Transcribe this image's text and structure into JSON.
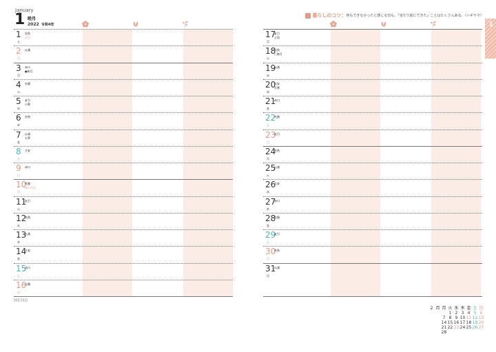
{
  "colors": {
    "accent": "#e39a86",
    "sunday": "#e39a86",
    "saturday": "#4ab6b7",
    "stripe": "#fbece5",
    "text": "#333333"
  },
  "header": {
    "month_en": "January",
    "month_num": "1",
    "month_jp": "睦月",
    "year": "2022",
    "reiwa": "令和4年"
  },
  "column_icons": [
    "flower-icon",
    "leaf-icon",
    "sprout-icon"
  ],
  "tip": {
    "title": "暮らしのコツ：",
    "text": "何もできなかったと感じる日も、「当たり前にできた」ことはたくさんある。（ハギヤマ）"
  },
  "tab_label": "1",
  "memo_label": "MEMO",
  "left_days": [
    {
      "day": "1",
      "weekday": "土",
      "rokuyo": "先負",
      "note": "元日",
      "color": "black",
      "note_color": "red",
      "week_start": false
    },
    {
      "day": "2",
      "weekday": "日",
      "rokuyo": "仏滅",
      "note": "",
      "color": "red",
      "note_color": "black",
      "week_start": false
    },
    {
      "day": "3",
      "weekday": "月",
      "rokuyo": "赤口",
      "note": "●新月",
      "color": "black",
      "note_color": "black",
      "week_start": true
    },
    {
      "day": "4",
      "weekday": "火",
      "rokuyo": "先勝",
      "note": "",
      "color": "black",
      "note_color": "black",
      "week_start": false
    },
    {
      "day": "5",
      "weekday": "水",
      "rokuyo": "友引",
      "note": "小寒",
      "color": "black",
      "note_color": "black",
      "week_start": false
    },
    {
      "day": "6",
      "weekday": "木",
      "rokuyo": "先負",
      "note": "",
      "color": "black",
      "note_color": "black",
      "week_start": false
    },
    {
      "day": "7",
      "weekday": "金",
      "rokuyo": "仏滅",
      "note": "七草",
      "color": "black",
      "note_color": "black",
      "week_start": false
    },
    {
      "day": "8",
      "weekday": "土",
      "rokuyo": "大安",
      "note": "",
      "color": "blue",
      "note_color": "black",
      "week_start": false
    },
    {
      "day": "9",
      "weekday": "日",
      "rokuyo": "赤口",
      "note": "",
      "color": "red",
      "note_color": "black",
      "week_start": false
    },
    {
      "day": "10",
      "weekday": "月",
      "rokuyo": "先勝",
      "note": "成人の日",
      "color": "red",
      "note_color": "red",
      "week_start": true
    },
    {
      "day": "11",
      "weekday": "火",
      "rokuyo": "友引",
      "note": "",
      "color": "black",
      "note_color": "black",
      "week_start": false
    },
    {
      "day": "12",
      "weekday": "水",
      "rokuyo": "先負",
      "note": "",
      "color": "black",
      "note_color": "black",
      "week_start": false
    },
    {
      "day": "13",
      "weekday": "木",
      "rokuyo": "仏滅",
      "note": "",
      "color": "black",
      "note_color": "black",
      "week_start": false
    },
    {
      "day": "14",
      "weekday": "金",
      "rokuyo": "大安",
      "note": "",
      "color": "black",
      "note_color": "black",
      "week_start": false
    },
    {
      "day": "15",
      "weekday": "土",
      "rokuyo": "赤口",
      "note": "",
      "color": "blue",
      "note_color": "black",
      "week_start": false
    },
    {
      "day": "16",
      "weekday": "日",
      "rokuyo": "先勝",
      "note": "",
      "color": "red",
      "note_color": "black",
      "week_start": false
    }
  ],
  "right_days": [
    {
      "day": "17",
      "weekday": "月",
      "rokuyo": "友引",
      "note": "土用",
      "color": "black",
      "note_color": "black",
      "week_start": true
    },
    {
      "day": "18",
      "weekday": "火",
      "rokuyo": "先負",
      "note": "○満月",
      "color": "black",
      "note_color": "black",
      "week_start": false
    },
    {
      "day": "19",
      "weekday": "水",
      "rokuyo": "仏滅",
      "note": "",
      "color": "black",
      "note_color": "black",
      "week_start": false
    },
    {
      "day": "20",
      "weekday": "木",
      "rokuyo": "大安",
      "note": "大寒",
      "color": "black",
      "note_color": "black",
      "week_start": false
    },
    {
      "day": "21",
      "weekday": "金",
      "rokuyo": "赤口",
      "note": "",
      "color": "black",
      "note_color": "black",
      "week_start": false
    },
    {
      "day": "22",
      "weekday": "土",
      "rokuyo": "先勝",
      "note": "",
      "color": "blue",
      "note_color": "black",
      "week_start": false
    },
    {
      "day": "23",
      "weekday": "日",
      "rokuyo": "友引",
      "note": "",
      "color": "red",
      "note_color": "black",
      "week_start": false
    },
    {
      "day": "24",
      "weekday": "月",
      "rokuyo": "先負",
      "note": "",
      "color": "black",
      "note_color": "black",
      "week_start": true
    },
    {
      "day": "25",
      "weekday": "火",
      "rokuyo": "仏滅",
      "note": "",
      "color": "black",
      "note_color": "black",
      "week_start": false
    },
    {
      "day": "26",
      "weekday": "水",
      "rokuyo": "大安",
      "note": "",
      "color": "black",
      "note_color": "black",
      "week_start": false
    },
    {
      "day": "27",
      "weekday": "木",
      "rokuyo": "赤口",
      "note": "",
      "color": "black",
      "note_color": "black",
      "week_start": false
    },
    {
      "day": "28",
      "weekday": "金",
      "rokuyo": "先勝",
      "note": "",
      "color": "black",
      "note_color": "black",
      "week_start": false
    },
    {
      "day": "29",
      "weekday": "土",
      "rokuyo": "友引",
      "note": "",
      "color": "blue",
      "note_color": "black",
      "week_start": false
    },
    {
      "day": "30",
      "weekday": "日",
      "rokuyo": "先負",
      "note": "",
      "color": "red",
      "note_color": "black",
      "week_start": false
    },
    {
      "day": "31",
      "weekday": "月",
      "rokuyo": "仏滅",
      "note": "",
      "color": "black",
      "note_color": "black",
      "week_start": true
    }
  ],
  "mini_calendar": {
    "month": "2",
    "month_label": "月",
    "weekday_headers": [
      "月",
      "火",
      "水",
      "木",
      "金",
      "土",
      "日"
    ],
    "weeks": [
      [
        "",
        "1",
        "2",
        "3",
        "4",
        "5",
        "6"
      ],
      [
        "7",
        "8",
        "9",
        "10",
        "11",
        "12",
        "13"
      ],
      [
        "14",
        "15",
        "16",
        "17",
        "18",
        "19",
        "20"
      ],
      [
        "21",
        "22",
        "23",
        "24",
        "25",
        "26",
        "27"
      ],
      [
        "28",
        "",
        "",
        "",
        "",
        "",
        ""
      ]
    ],
    "holiday_days": [
      "11",
      "23"
    ]
  }
}
